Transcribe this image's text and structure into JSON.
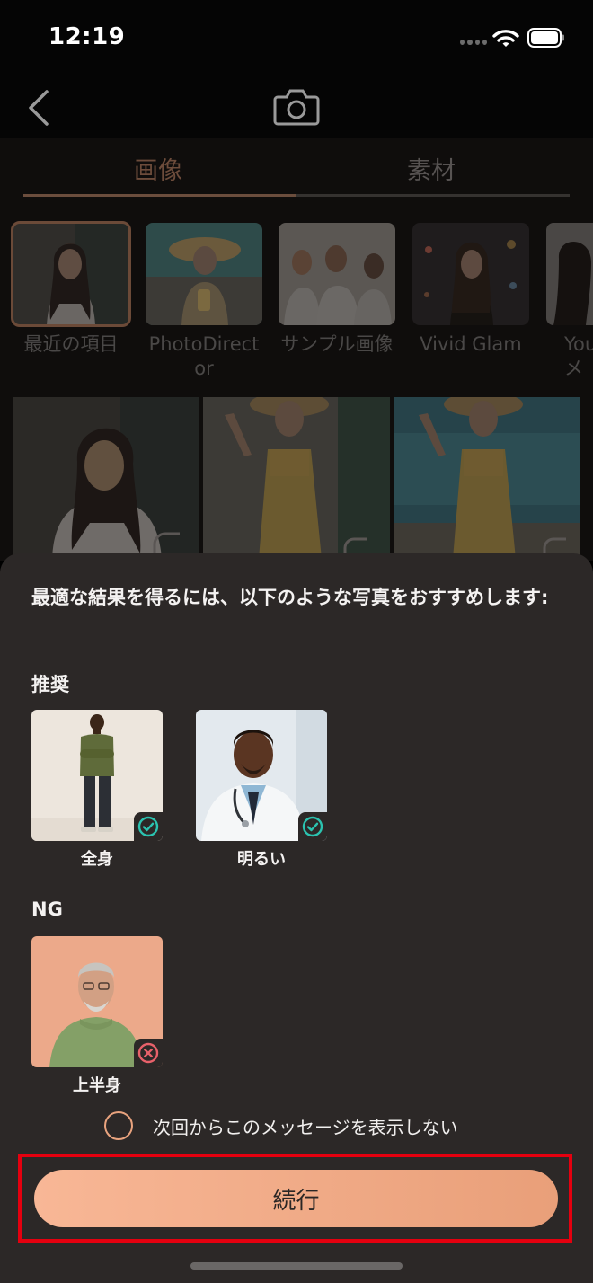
{
  "status_bar": {
    "time": "12:19"
  },
  "tabs": {
    "images": "画像",
    "materials": "素材"
  },
  "albums": [
    {
      "label": "最近の項目"
    },
    {
      "label": "PhotoDirector"
    },
    {
      "label": "サンプル画像"
    },
    {
      "label": "Vivid Glam"
    },
    {
      "label": "You\nメ"
    }
  ],
  "sheet": {
    "message": "最適な結果を得るには、以下のような写真をおすすめします:",
    "recommended_title": "推奨",
    "recommended": [
      {
        "caption": "全身",
        "badge": "check-icon"
      },
      {
        "caption": "明るい",
        "badge": "check-icon"
      }
    ],
    "ng_title": "NG",
    "ng": [
      {
        "caption": "上半身",
        "badge": "cross-icon"
      }
    ],
    "dont_show": "次回からこのメッセージを表示しない",
    "continue": "続行"
  },
  "colors": {
    "accent": "#e9a37e",
    "check": "#2bc3b0",
    "cross": "#e8616a",
    "highlight": "#e5000f"
  }
}
